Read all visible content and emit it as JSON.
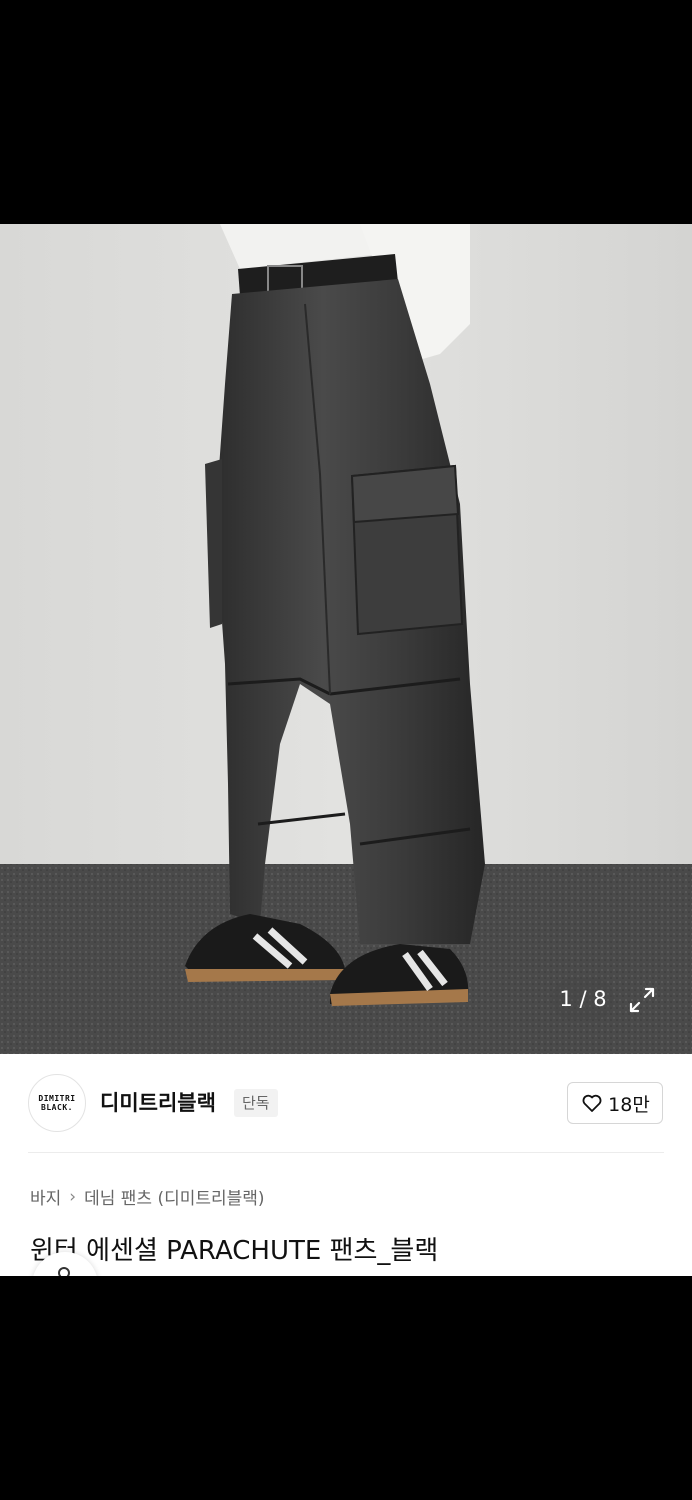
{
  "gallery": {
    "counter": "1 / 8",
    "expand_icon": "expand-icon"
  },
  "brand": {
    "logo_line1": "DIMITRI",
    "logo_line2": "BLACK.",
    "name": "디미트리블랙",
    "badge": "단독"
  },
  "like": {
    "icon": "heart-icon",
    "count": "18만"
  },
  "breadcrumb": {
    "category": "바지",
    "subcategory": "데님 팬츠 (디미트리블랙)"
  },
  "product": {
    "title": "윈터 에센셜 PARACHUTE 팬츠_블랙"
  },
  "colors": {
    "background": "#ffffff",
    "text": "#111111",
    "muted": "#666666"
  }
}
